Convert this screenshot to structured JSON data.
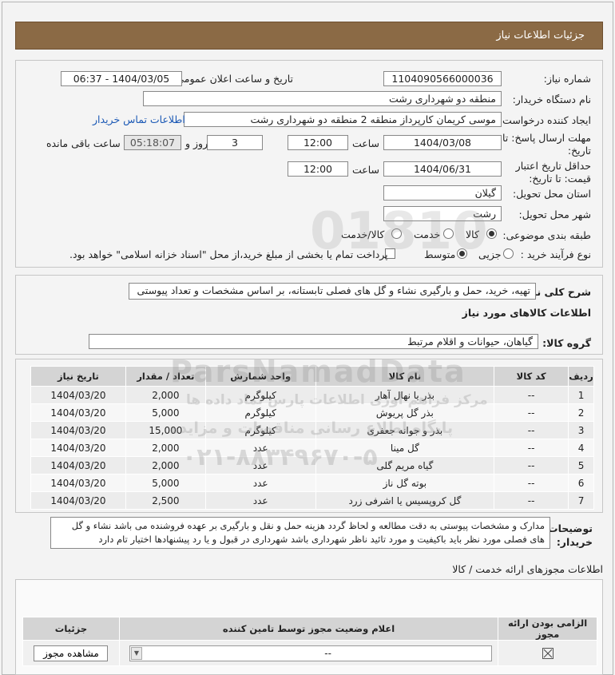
{
  "header": {
    "title": "جزئیات اطلاعات نیاز"
  },
  "info": {
    "need_number_label": "شماره نیاز:",
    "need_number": "1104090566000036",
    "announce_label": "تاریخ و ساعت اعلان عمومی:",
    "announce_value": "1404/03/05 - 06:37",
    "buyer_org_label": "نام دستگاه خریدار:",
    "buyer_org": "منطقه دو شهرداری رشت",
    "creator_label": "ایجاد کننده درخواست:",
    "creator": "موسی کریمان کارپرداز منطقه 2 منطقه دو شهرداری رشت",
    "contact_link": "اطلاعات تماس خریدار",
    "deadline_label": "مهلت ارسال پاسخ: تا تاریخ:",
    "deadline_date": "1404/03/08",
    "time_label": "ساعت",
    "deadline_time": "12:00",
    "days_value": "3",
    "days_label": "روز و",
    "remaining_time": "05:18:07",
    "remaining_label": "ساعت باقی مانده",
    "validity_label": "حداقل تاریخ اعتبار قیمت: تا تاریخ:",
    "validity_date": "1404/06/31",
    "validity_time": "12:00",
    "province_label": "استان محل تحویل:",
    "province": "گیلان",
    "city_label": "شهر محل تحویل:",
    "city": "رشت",
    "category_label": "طبقه بندی موضوعی:",
    "category_options": [
      "کالا",
      "خدمت",
      "کالا/خدمت"
    ],
    "process_label": "نوع فرآیند خرید :",
    "process_options": [
      "جزیی",
      "متوسط"
    ],
    "payment_note": "پرداخت تمام یا بخشی از مبلغ خرید،از محل \"اسناد خزانه اسلامی\" خواهد بود."
  },
  "description": {
    "label": "شرح کلی نیاز:",
    "text": "تهیه، خرید، حمل و بارگیری نشاء و گل های فصلی تابستانه، بر اساس مشخصات و تعداد پیوستی",
    "goods_info_title": "اطلاعات کالاهای مورد نیاز",
    "group_label": "گروه کالا:",
    "group_value": "گیاهان، حیوانات و اقلام مرتبط"
  },
  "table": {
    "headers": [
      "ردیف",
      "کد کالا",
      "نام کالا",
      "واحد شمارش",
      "تعداد / مقدار",
      "تاریخ نیاز"
    ],
    "rows": [
      [
        "1",
        "--",
        "بذر یا نهال آهار",
        "کیلوگرم",
        "2,000",
        "1404/03/20"
      ],
      [
        "2",
        "--",
        "بذر گل پریوش",
        "کیلوگرم",
        "5,000",
        "1404/03/20"
      ],
      [
        "3",
        "--",
        "بذر و جوانه جعفری",
        "کیلوگرم",
        "15,000",
        "1404/03/20"
      ],
      [
        "4",
        "--",
        "گل مینا",
        "عدد",
        "2,000",
        "1404/03/20"
      ],
      [
        "5",
        "--",
        "گیاه مریم گلی",
        "عدد",
        "2,000",
        "1404/03/20"
      ],
      [
        "6",
        "--",
        "بوته گل ناز",
        "عدد",
        "5,000",
        "1404/03/20"
      ],
      [
        "7",
        "--",
        "گل کروپسیس یا اشرفی زرد",
        "عدد",
        "2,500",
        "1404/03/20"
      ]
    ]
  },
  "notes": {
    "label": "توضیحات خریدار:",
    "text": "مدارک و مشخصات پیوستی به دقت مطالعه و لحاظ گردد هزینه حمل و نقل و بارگیری بر عهده فروشنده می باشد نشاء و گل های فصلی مورد نظر باید باکیفیت و مورد تائید ناظر شهرداری باشد شهرداری در قبول و یا رد پیشنهادها اختیار تام دارد"
  },
  "permits": {
    "title": "اطلاعات مجوزهای ارائه خدمت / کالا",
    "headers": [
      "الزامی بودن ارائه مجوز",
      "اعلام وضعیت مجوز توسط تامین کننده",
      "جزئیات"
    ],
    "select_value": "--",
    "view_button": "مشاهده مجوز"
  },
  "watermark": {
    "line1": "ParsNamadData",
    "line2": "مرکز فراهم آوری اطلاعات پارس نماد داده ها",
    "line3": "پایگاه اطلاع رسانی مناقصات و مزایده",
    "phone": "۰۲۱-۸۸۳۴۹۶۷۰-۵"
  }
}
